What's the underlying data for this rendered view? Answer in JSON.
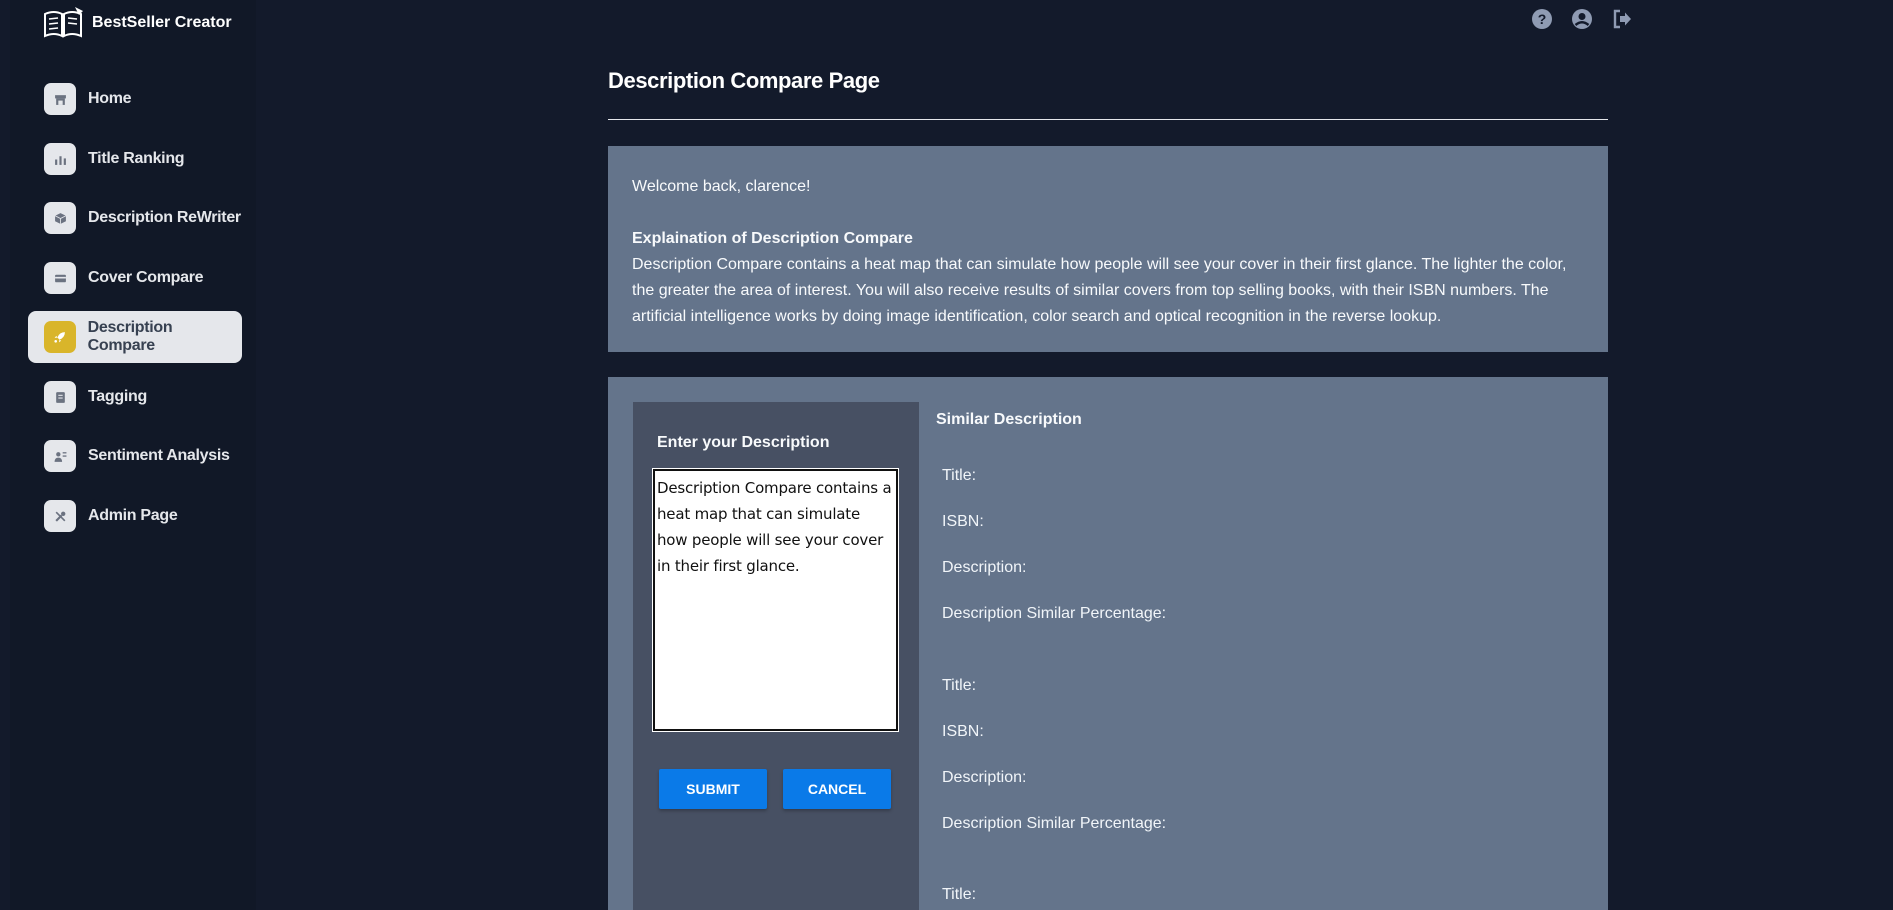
{
  "app": {
    "name": "BestSeller Creator"
  },
  "sidebar": {
    "items": [
      {
        "label": "Home",
        "icon": "store-icon",
        "active": false
      },
      {
        "label": "Title Ranking",
        "icon": "chart-bar-icon",
        "active": false
      },
      {
        "label": "Description ReWriter",
        "icon": "cube-icon",
        "active": false
      },
      {
        "label": "Cover Compare",
        "icon": "credit-card-icon",
        "active": false
      },
      {
        "label": "Description Compare",
        "icon": "rocket-icon",
        "active": true
      },
      {
        "label": "Tagging",
        "icon": "document-icon",
        "active": false
      },
      {
        "label": "Sentiment Analysis",
        "icon": "user-settings-icon",
        "active": false
      },
      {
        "label": "Admin Page",
        "icon": "tools-icon",
        "active": false
      }
    ]
  },
  "header": {
    "icons": [
      "help-icon",
      "account-icon",
      "logout-icon"
    ]
  },
  "main": {
    "title": "Description Compare Page",
    "welcome": {
      "greeting": "Welcome back, clarence!",
      "heading": "Explaination of Description Compare",
      "body": "Description Compare contains a heat map that can simulate how people will see your cover in their first glance. The lighter the color, the greater the area of interest. You will also receive results of similar covers from top selling books, with their ISBN numbers. The artificial intelligence works by doing image identification, color search and optical recognition in the reverse lookup."
    },
    "input": {
      "title": "Enter your Description",
      "value": "Description Compare contains a heat map that can simulate how people will see your cover in their first glance.",
      "submit_label": "SUBMIT",
      "cancel_label": "CANCEL"
    },
    "results": {
      "title": "Similar Description",
      "lines": [
        "Title:",
        "ISBN:",
        "Description:",
        "Description Similar Percentage:",
        "Title:",
        "ISBN:",
        "Description:",
        "Description Similar Percentage:",
        "Title:"
      ]
    }
  },
  "colors": {
    "background": "#131a2b",
    "panel": "#64748b",
    "card": "#475063",
    "button": "#0a7ae8",
    "active_icon": "#d9b52a"
  }
}
